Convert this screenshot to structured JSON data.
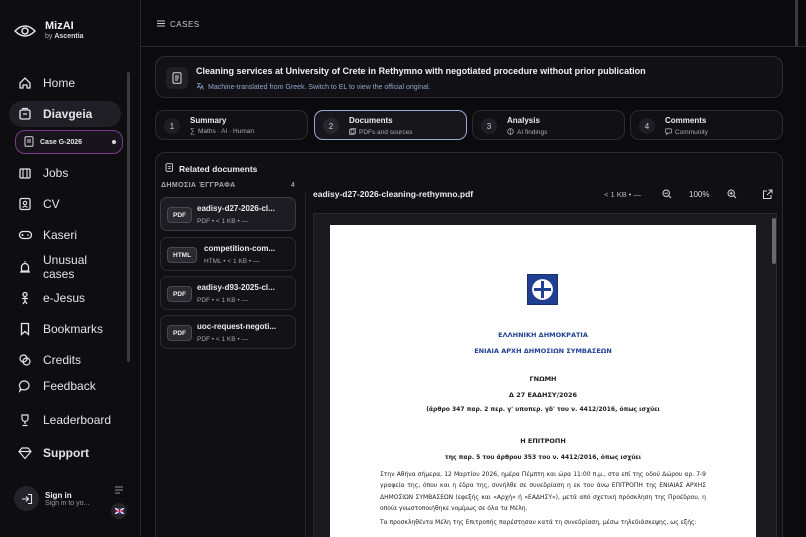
{
  "brand": {
    "name": "MizAI",
    "by_prefix": "by",
    "by_name": "Ascentia"
  },
  "sidebar": {
    "items": [
      {
        "label": "Home",
        "icon": "home-icon"
      },
      {
        "label": "Diavgeia",
        "icon": "document-stack-icon",
        "active": true
      },
      {
        "label": "Jobs",
        "icon": "building-icon"
      },
      {
        "label": "CV",
        "icon": "id-card-icon"
      },
      {
        "label": "Kaseri",
        "icon": "gamepad-icon"
      },
      {
        "label": "Unusual cases",
        "icon": "siren-icon"
      },
      {
        "label": "e-Jesus",
        "icon": "person-icon"
      },
      {
        "label": "Bookmarks",
        "icon": "bookmark-icon"
      },
      {
        "label": "Credits",
        "icon": "coins-icon"
      },
      {
        "label": "Feedback",
        "icon": "chat-bubble-icon"
      },
      {
        "label": "Leaderboard",
        "icon": "trophy-icon"
      },
      {
        "label": "Support",
        "icon": "diamond-icon"
      }
    ],
    "sub_item": "Case G-2026",
    "signin": {
      "title": "Sign in",
      "subtitle": "Sign in to yo..."
    }
  },
  "breadcrumb": {
    "label": "CASES"
  },
  "case": {
    "title": "Cleaning services at University of Crete in Rethymno with negotiated procedure without prior publication",
    "note": "Machine-translated from Greek. Switch to EL to view the official original."
  },
  "steps": [
    {
      "num": "1",
      "title": "Summary",
      "sub": "Maths · AI · Human",
      "icon": "sigma-icon"
    },
    {
      "num": "2",
      "title": "Documents",
      "sub": "PDFs and sources",
      "icon": "docs-icon",
      "active": true
    },
    {
      "num": "3",
      "title": "Analysis",
      "sub": "AI findings",
      "icon": "brain-icon"
    },
    {
      "num": "4",
      "title": "Comments",
      "sub": "Community",
      "icon": "comment-icon"
    }
  ],
  "documents": {
    "heading": "Related documents",
    "column_label": "ΔΗΜΟΣΙΑ ΈΓΓΡΑΦΑ",
    "count": "4",
    "items": [
      {
        "type": "PDF",
        "name": "eadisy-d27-2026-cl...",
        "meta": "PDF • < 1 KB • —",
        "active": true
      },
      {
        "type": "HTML",
        "name": "competition-com...",
        "meta": "HTML • < 1 KB • —"
      },
      {
        "type": "PDF",
        "name": "eadisy-d93-2025-cl...",
        "meta": "PDF • < 1 KB • —"
      },
      {
        "type": "PDF",
        "name": "uoc-request-negoti...",
        "meta": "PDF • < 1 KB • —"
      }
    ]
  },
  "viewer": {
    "filename": "eadisy-d27-2026-cleaning-rethymno.pdf",
    "meta": "< 1 KB • —",
    "zoom": "100%"
  },
  "pdf": {
    "l1": "ΕΛΛΗΝΙΚΗ ΔΗΜΟΚΡΑΤΙΑ",
    "l2": "ΕΝΙΑΙΑ ΑΡΧΗ ΔΗΜΟΣΙΩΝ ΣΥΜΒΑΣΕΩΝ",
    "l3": "ΓΝΩΜΗ",
    "l4": "Δ 27 ΕΑΔΗΣΥ/2026",
    "l5": "(άρθρο 347 παρ. 2 περ. γ' υποπερ. γδ' του ν. 4412/2016, όπως ισχύει",
    "l6": "Η ΕΠΙΤΡΟΠΗ",
    "l7": "της παρ. 5 του άρθρου 353 του ν. 4412/2016, όπως ισχύει",
    "p1": "Στην Αθήνα σήμερα, 12 Μαρτίου 2026, ημέρα Πέμπτη και ώρα 11:00 π.μ., στα επί της οδού Δώρου αρ. 7-9 γραφεία της, όπου και η έδρα της, συνήλθε σε συνεδρίαση η εκ του άνω ΕΠΙΤΡΟΠΗ της ΕΝΙΑΙΑΣ ΑΡΧΗΣ ΔΗΜΟΣΙΩΝ ΣΥΜΒΑΣΕΩΝ (εφεξής και «Αρχή» ή «ΕΑΔΗΣΥ»), μετά από σχετική πρόσκληση της Προέδρου, η οποία γνωστοποιήθηκε νομίμως σε όλα τα Μέλη.",
    "p2": "Τα προσκληθέντα Μέλη της Επιτροπής παρέστησαν κατά τη συνεδρίαση, μέσω τηλεδιάσκεψης, ως εξής:"
  }
}
